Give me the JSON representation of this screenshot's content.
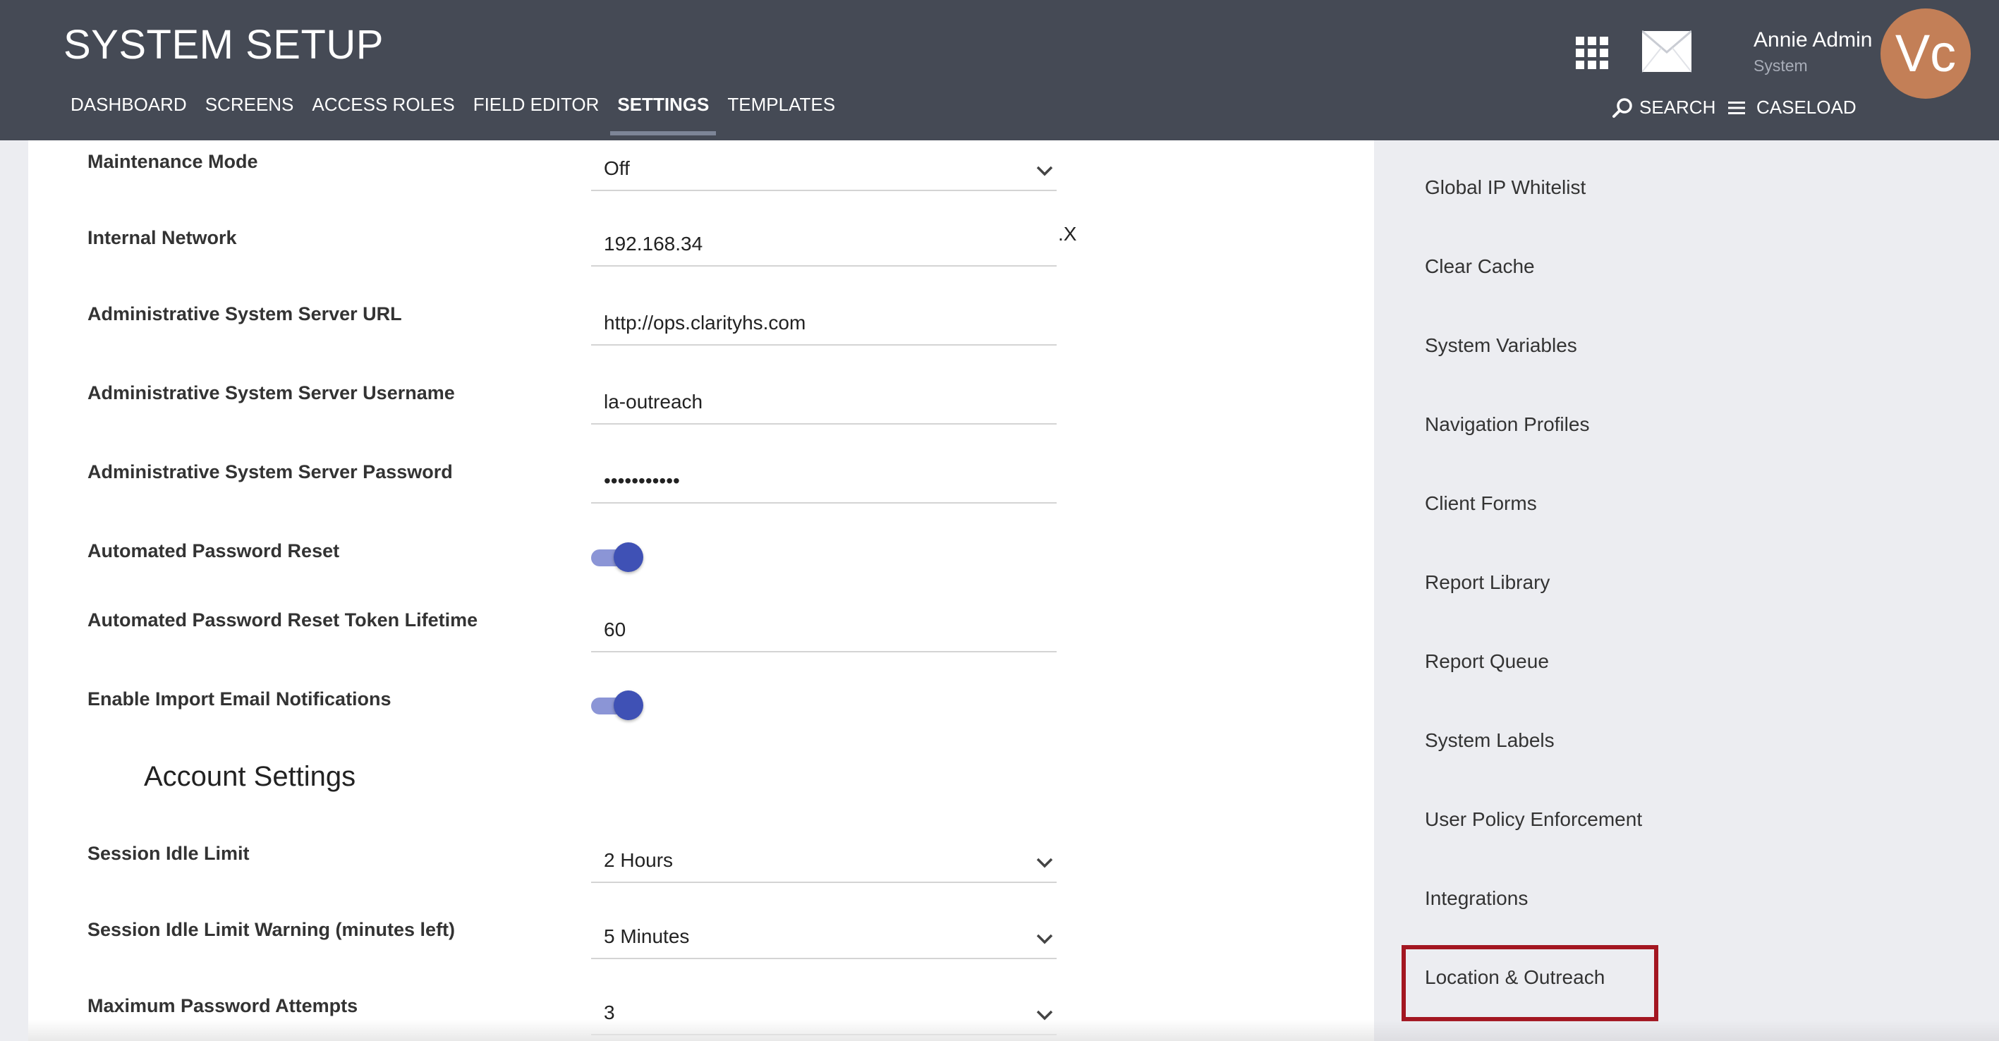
{
  "header": {
    "title": "SYSTEM SETUP",
    "nav": [
      "DASHBOARD",
      "SCREENS",
      "ACCESS ROLES",
      "FIELD EDITOR",
      "SETTINGS",
      "TEMPLATES"
    ],
    "active_nav": "SETTINGS",
    "user_name": "Annie Admin",
    "user_role": "System",
    "avatar_initials": "Vc",
    "avatar_color": "#c37f57",
    "search_label": "SEARCH",
    "caseload_label": "CASELOAD",
    "bar_color": "#454a55"
  },
  "settings": {
    "maintenance_mode": {
      "label": "Maintenance Mode",
      "value": "Off"
    },
    "internal_network": {
      "label": "Internal Network",
      "value": "192.168.34",
      "suffix": ".X"
    },
    "admin_server_url": {
      "label": "Administrative System Server URL",
      "value": "http://ops.clarityhs.com"
    },
    "admin_server_username": {
      "label": "Administrative System Server Username",
      "value": "la-outreach"
    },
    "admin_server_password": {
      "label": "Administrative System Server Password",
      "value": "•••••••••••"
    },
    "automated_password_reset": {
      "label": "Automated Password Reset",
      "enabled": true
    },
    "reset_token_lifetime": {
      "label": "Automated Password Reset Token Lifetime",
      "value": "60"
    },
    "import_email_notifications": {
      "label": "Enable Import Email Notifications",
      "enabled": true
    }
  },
  "account_settings": {
    "heading": "Account Settings",
    "session_idle_limit": {
      "label": "Session Idle Limit",
      "value": "2 Hours"
    },
    "session_idle_warning": {
      "label": "Session Idle Limit Warning (minutes left)",
      "value": "5 Minutes"
    },
    "max_password_attempts": {
      "label": "Maximum Password Attempts",
      "value": "3"
    }
  },
  "sidebar": {
    "items": [
      "Global IP Whitelist",
      "Clear Cache",
      "System Variables",
      "Navigation Profiles",
      "Client Forms",
      "Report Library",
      "Report Queue",
      "System Labels",
      "User Policy Enforcement",
      "Integrations",
      "Location & Outreach"
    ],
    "highlighted_item": "Location & Outreach",
    "highlight_color": "#a31621"
  },
  "toggle_color": "#3f51b5"
}
